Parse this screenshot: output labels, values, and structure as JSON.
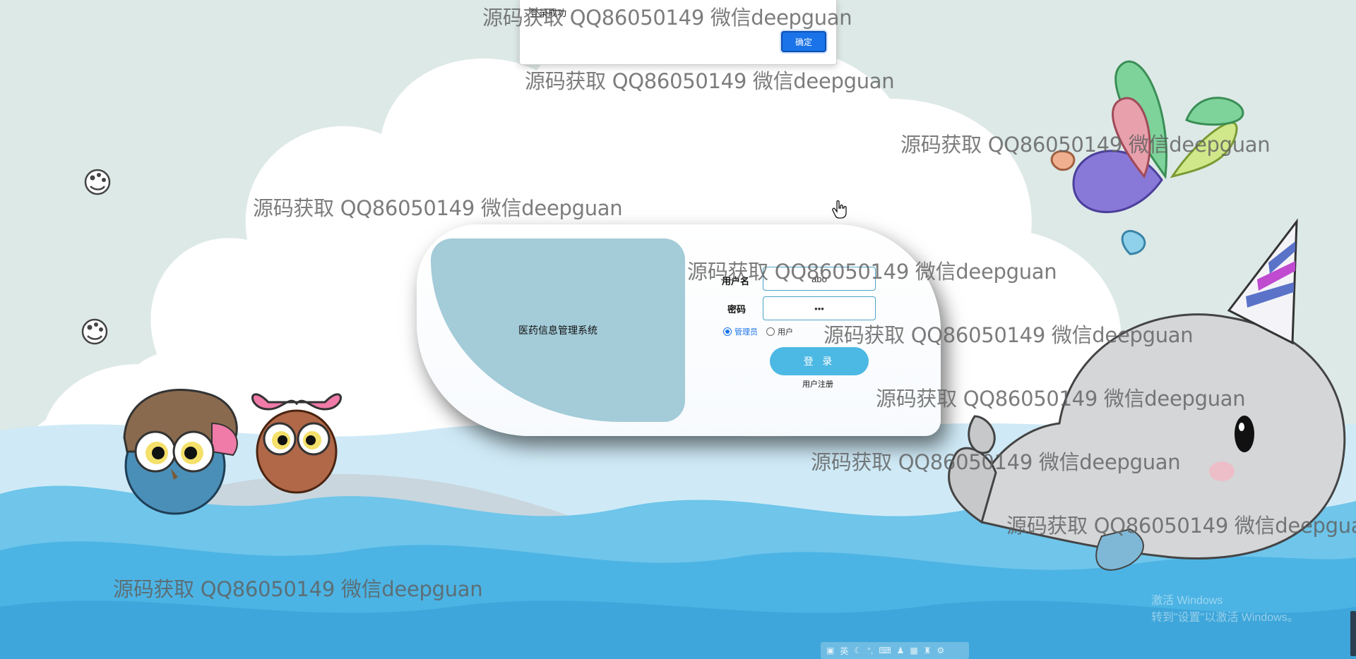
{
  "alert": {
    "message": "登录成功",
    "ok_label": "确定"
  },
  "login": {
    "system_title": "医药信息管理系统",
    "username_label": "用户名",
    "username_value": "abo",
    "password_label": "密码",
    "password_value": "•••",
    "role_options": [
      {
        "label": "管理员",
        "selected": true
      },
      {
        "label": "用户",
        "selected": false
      }
    ],
    "login_label": "登 录",
    "register_label": "用户注册"
  },
  "watermark_text": "源码获取 QQ86050149 微信deepguan",
  "windows_activation": {
    "line1": "激活 Windows",
    "line2": "转到\"设置\"以激活 Windows。"
  },
  "ime_toolbar": {
    "mode": "英"
  },
  "colors": {
    "card_panel": "#a3cbd8",
    "login_button": "#4cb8e4",
    "confirm_button": "#1a73e8",
    "sea": "#4cb4e4"
  },
  "icons": [
    "palette-icon",
    "palette-icon",
    "hand-cursor-icon",
    "whale-illustration",
    "owls-illustration",
    "fountain-illustration",
    "ime-toolbar"
  ]
}
